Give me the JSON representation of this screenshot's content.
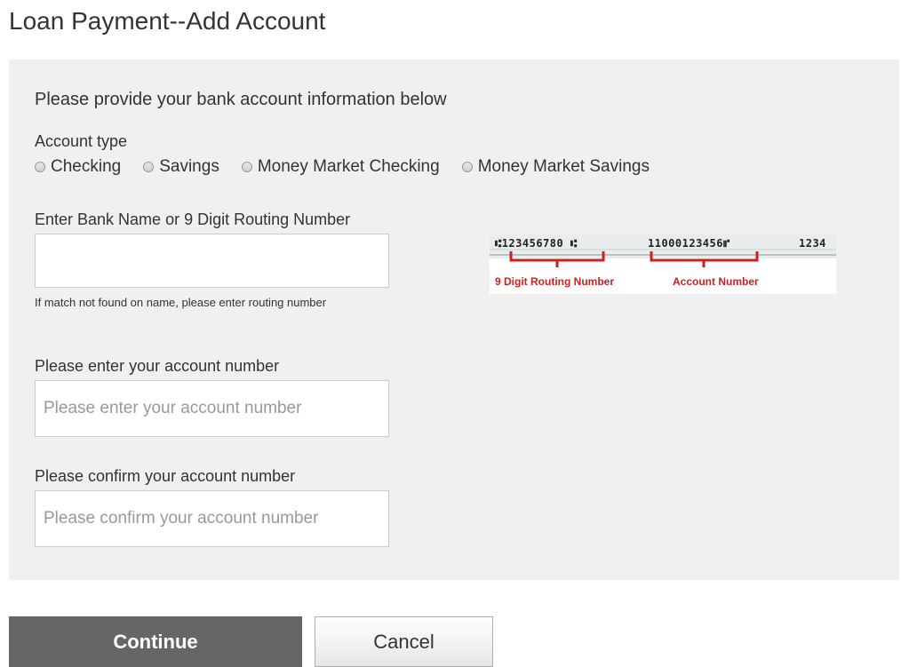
{
  "page": {
    "title": "Loan Payment--Add Account"
  },
  "form": {
    "intro": "Please provide your bank account information below",
    "account_type": {
      "label": "Account type",
      "options": [
        "Checking",
        "Savings",
        "Money Market Checking",
        "Money Market Savings"
      ],
      "selected": null
    },
    "bank": {
      "label": "Enter Bank Name or 9 Digit Routing Number",
      "value": "",
      "hint": "If match not found on name, please enter routing number"
    },
    "check_example": {
      "micr_routing": "⑆123456780 ⑆",
      "micr_account": "11000123456⑈",
      "micr_check": "1234",
      "routing_caption": "9 Digit Routing Number",
      "account_caption": "Account Number",
      "caption_color": "#cc1f1f"
    },
    "account_number": {
      "label": "Please enter your account number",
      "placeholder": "Please enter your account number",
      "value": ""
    },
    "confirm_account_number": {
      "label": "Please confirm your account number",
      "placeholder": "Please confirm your account number",
      "value": ""
    }
  },
  "buttons": {
    "continue_label": "Continue",
    "cancel_label": "Cancel"
  },
  "colors": {
    "panel_bg": "#f0f0f0",
    "continue_bg": "#666666"
  }
}
